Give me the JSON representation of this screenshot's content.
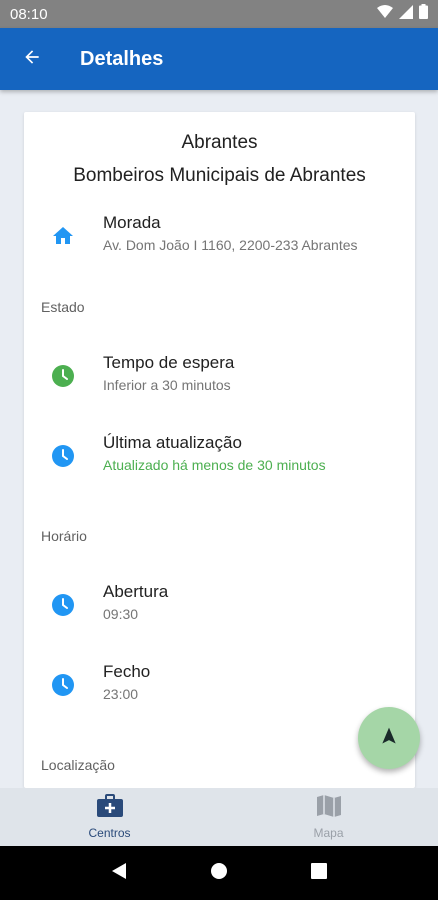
{
  "status_bar": {
    "time": "08:10"
  },
  "app_bar": {
    "title": "Detalhes",
    "back_icon": "arrow-back-icon"
  },
  "details": {
    "city": "Abrantes",
    "name": "Bombeiros Municipais de Abrantes",
    "address": {
      "label": "Morada",
      "value": "Av. Dom João I 1160, 2200-233 Abrantes",
      "icon": "home-icon"
    }
  },
  "estado": {
    "section_label": "Estado",
    "wait_time": {
      "label": "Tempo de espera",
      "value": "Inferior a 30 minutos",
      "icon": "clock-icon",
      "icon_color": "#4caf50"
    },
    "last_update": {
      "label": "Última atualização",
      "value": "Atualizado há menos de 30 minutos",
      "icon": "clock-icon",
      "icon_color": "#2196f3",
      "value_color": "#4caf50"
    }
  },
  "horario": {
    "section_label": "Horário",
    "opening": {
      "label": "Abertura",
      "value": "09:30",
      "icon": "clock-icon"
    },
    "closing": {
      "label": "Fecho",
      "value": "23:00",
      "icon": "clock-icon"
    }
  },
  "localizacao": {
    "section_label": "Localização"
  },
  "fab": {
    "icon": "navigation-arrow-icon",
    "color": "#a5d6a7"
  },
  "bottom_nav": {
    "items": [
      {
        "label": "Centros",
        "icon": "medical-kit-icon",
        "active": true
      },
      {
        "label": "Mapa",
        "icon": "map-icon",
        "active": false
      }
    ]
  },
  "colors": {
    "primary": "#1565c0",
    "accent_blue": "#2196f3",
    "green": "#4caf50"
  }
}
